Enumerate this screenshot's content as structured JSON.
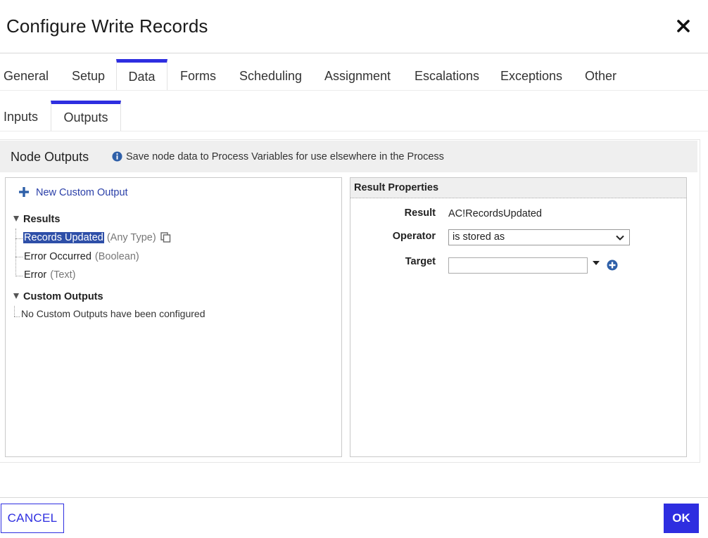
{
  "dialog": {
    "title": "Configure Write Records",
    "close_icon": "close-icon"
  },
  "tabs": [
    {
      "label": "General"
    },
    {
      "label": "Setup"
    },
    {
      "label": "Data",
      "active": true
    },
    {
      "label": "Forms"
    },
    {
      "label": "Scheduling"
    },
    {
      "label": "Assignment"
    },
    {
      "label": "Escalations"
    },
    {
      "label": "Exceptions"
    },
    {
      "label": "Other"
    }
  ],
  "subtabs": [
    {
      "label": "Inputs"
    },
    {
      "label": "Outputs",
      "active": true
    }
  ],
  "section": {
    "title": "Node Outputs",
    "info_text": "Save node data to Process Variables for use elsewhere in the Process"
  },
  "outputs_tree": {
    "new_output_label": "New Custom Output",
    "results_label": "Results",
    "results": [
      {
        "label": "Records Updated",
        "type": "(Any Type)",
        "selected": true
      },
      {
        "label": "Error Occurred",
        "type": "(Boolean)"
      },
      {
        "label": "Error",
        "type": "(Text)"
      }
    ],
    "custom_label": "Custom Outputs",
    "custom_empty": "No Custom Outputs have been configured"
  },
  "result_properties": {
    "title": "Result Properties",
    "result_label": "Result",
    "result_value": "AC!RecordsUpdated",
    "operator_label": "Operator",
    "operator_value": "is stored as",
    "target_label": "Target",
    "target_value": ""
  },
  "footer": {
    "cancel_label": "CANCEL",
    "ok_label": "OK"
  },
  "colors": {
    "accent": "#2e2ee0",
    "selection": "#2e4fa8",
    "link": "#2a3fa8"
  }
}
